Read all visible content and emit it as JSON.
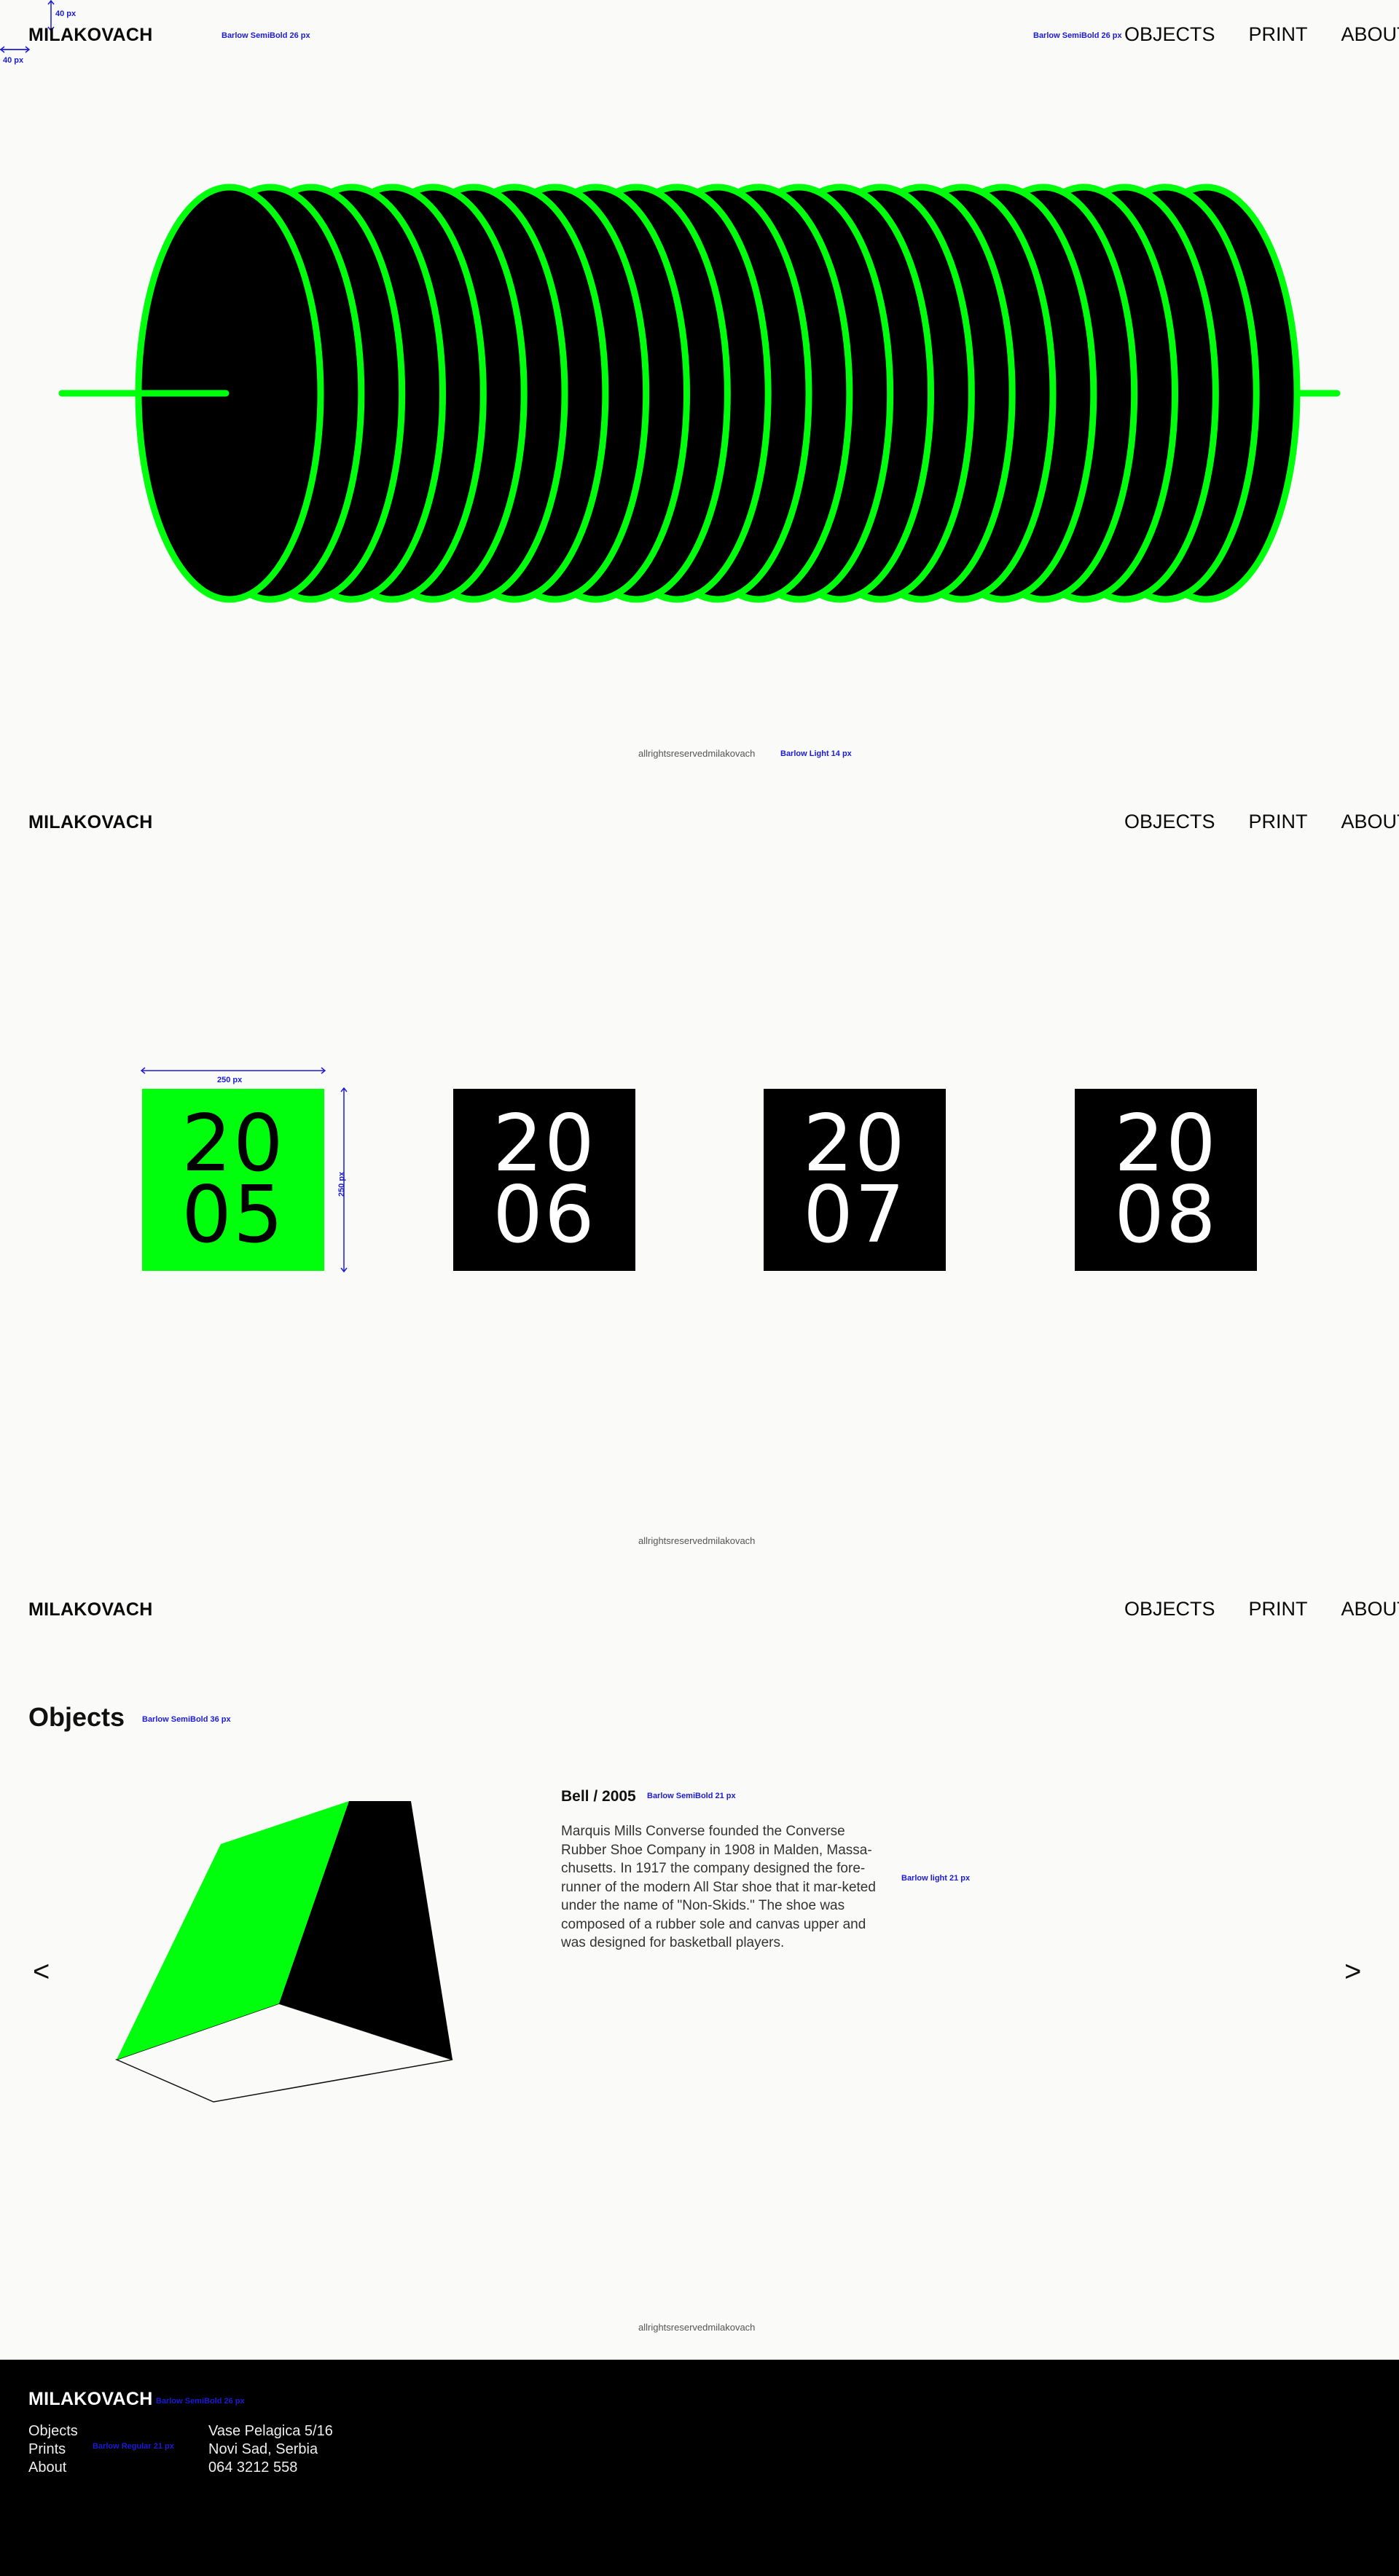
{
  "brand": "MILAKOVACH",
  "nav": {
    "objects": "OBJECTS",
    "print": "PRINT",
    "about": "ABOUT"
  },
  "copyright": "allrightsreservedmilakovach",
  "annotations": {
    "margin_top": "40 px",
    "margin_left": "40 px",
    "logo_font": "Barlow SemiBold 26 px",
    "nav_font": "Barlow SemiBold 26 px",
    "copyright_font": "Barlow Light 14 px",
    "box_width": "250 px",
    "box_height": "250 px",
    "objects_font": "Barlow SemiBold 36 px",
    "obj_title_font": "Barlow SemiBold 21 px",
    "obj_desc_font": "Barlow light 21 px",
    "footer_logo_font": "Barlow SemiBold 26 px",
    "footer_list_font": "Barlow Regular 21 px"
  },
  "years": [
    {
      "top": "20",
      "bottom": "05",
      "active": true
    },
    {
      "top": "20",
      "bottom": "06",
      "active": false
    },
    {
      "top": "20",
      "bottom": "07",
      "active": false
    },
    {
      "top": "20",
      "bottom": "08",
      "active": false
    }
  ],
  "objects": {
    "title": "Objects",
    "item_title": "Bell / 2005",
    "description": "Marquis Mills Converse founded the Converse Rubber Shoe Company in 1908 in Malden, Massa-chusetts. In 1917 the company designed the fore-runner of the modern All Star shoe that it mar-keted under the name of \"Non-Skids.\" The shoe was composed of a rubber sole and canvas upper and was designed for basketball players.",
    "prev": "<",
    "next": ">"
  },
  "footer": {
    "brand": "MILAKOVACH",
    "links": [
      "Objects",
      "Prints",
      "About"
    ],
    "address": [
      "Vase Pelagica 5/16",
      "Novi Sad, Serbia",
      "064 3212 558"
    ]
  },
  "colors": {
    "accent": "#00ff0d",
    "black": "#000000",
    "annotation": "#1b1bd6",
    "background": "#fafaf8"
  }
}
